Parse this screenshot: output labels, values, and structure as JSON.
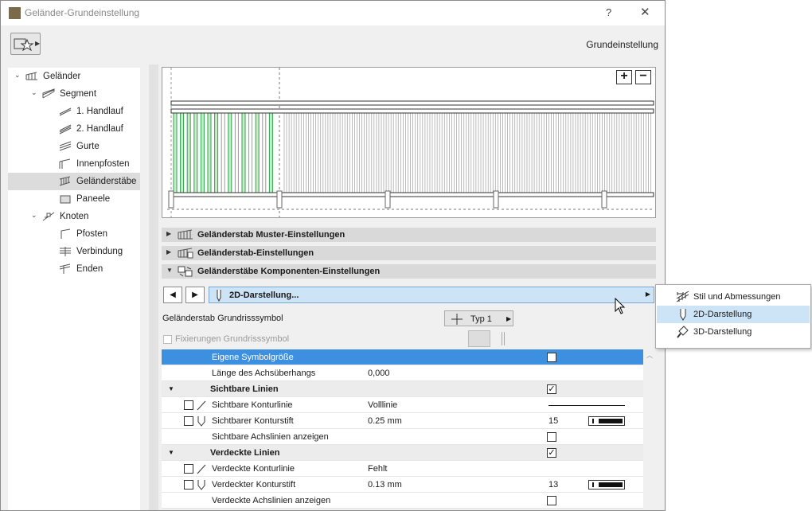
{
  "window": {
    "title": "Geländer-Grundeinstellung",
    "help": "?",
    "close": "✕",
    "header_label": "Grundeinstellung"
  },
  "tree": {
    "items": [
      {
        "label": "Geländer",
        "expander": "⌄",
        "icon": "railing-icon"
      },
      {
        "label": "Segment",
        "expander": "⌄",
        "icon": "segment-icon"
      },
      {
        "label": "1. Handlauf",
        "icon": "handrail-icon"
      },
      {
        "label": "2. Handlauf",
        "icon": "handrail-icon"
      },
      {
        "label": "Gurte",
        "icon": "rail-icon"
      },
      {
        "label": "Innenpfosten",
        "icon": "inner-post-icon"
      },
      {
        "label": "Geländerstäbe",
        "icon": "baluster-icon",
        "selected": true
      },
      {
        "label": "Paneele",
        "icon": "panel-icon"
      },
      {
        "label": "Knoten",
        "expander": "⌄",
        "icon": "node-icon"
      },
      {
        "label": "Pfosten",
        "icon": "post-icon"
      },
      {
        "label": "Verbindung",
        "icon": "connection-icon"
      },
      {
        "label": "Enden",
        "icon": "ends-icon"
      }
    ]
  },
  "preview": {
    "zoom_in": "+",
    "zoom_out": "−",
    "highlight_color": "#2ea44f"
  },
  "sections": [
    {
      "label": "Geländerstab Muster-Einstellungen",
      "expander": "▶"
    },
    {
      "label": "Geländerstab-Einstellungen",
      "expander": "▶"
    },
    {
      "label": "Geländerstäbe Komponenten-Einstellungen",
      "expander": "▼"
    }
  ],
  "component_nav": {
    "prev": "◀",
    "next": "▶",
    "selected": "2D-Darstellung...",
    "arrow": "▶"
  },
  "symbol": {
    "label": "Geländerstab Grundrisssymbol",
    "type_value": "Typ 1",
    "type_arrow": "▶",
    "fixings_label": "Fixierungen Grundrisssymbol"
  },
  "grid": {
    "rows": [
      {
        "name": "Eigene Symbolgröße",
        "value": "",
        "check": "",
        "highlight": true
      },
      {
        "name": "Länge des Achsüberhangs",
        "value": "0,000"
      },
      {
        "name": "Sichtbare Linien",
        "group": true,
        "check": "✓",
        "expander": "▼"
      },
      {
        "name": "Sichtbare Konturlinie",
        "value": "Volllinie",
        "line_sample": true
      },
      {
        "name": "Sichtbarer Konturstift",
        "value": "0.25 mm",
        "pen": "15"
      },
      {
        "name": "Sichtbare Achslinien anzeigen",
        "check": ""
      },
      {
        "name": "Verdeckte Linien",
        "group": true,
        "check": "✓",
        "expander": "▼"
      },
      {
        "name": "Verdeckte Konturlinie",
        "value": "Fehlt"
      },
      {
        "name": "Verdeckter Konturstift",
        "value": "0.13 mm",
        "pen": "13"
      },
      {
        "name": "Verdeckte Achslinien anzeigen",
        "check": ""
      }
    ]
  },
  "popup": {
    "items": [
      {
        "label": "Stil und Abmessungen",
        "icon": "style-dimensions-icon"
      },
      {
        "label": "2D-Darstellung",
        "icon": "2d-pen-icon",
        "selected": true
      },
      {
        "label": "3D-Darstellung",
        "icon": "3d-brush-icon"
      }
    ]
  },
  "colors": {
    "accent_blue": "#3d8fe0",
    "selection_light": "#cde4f7"
  }
}
